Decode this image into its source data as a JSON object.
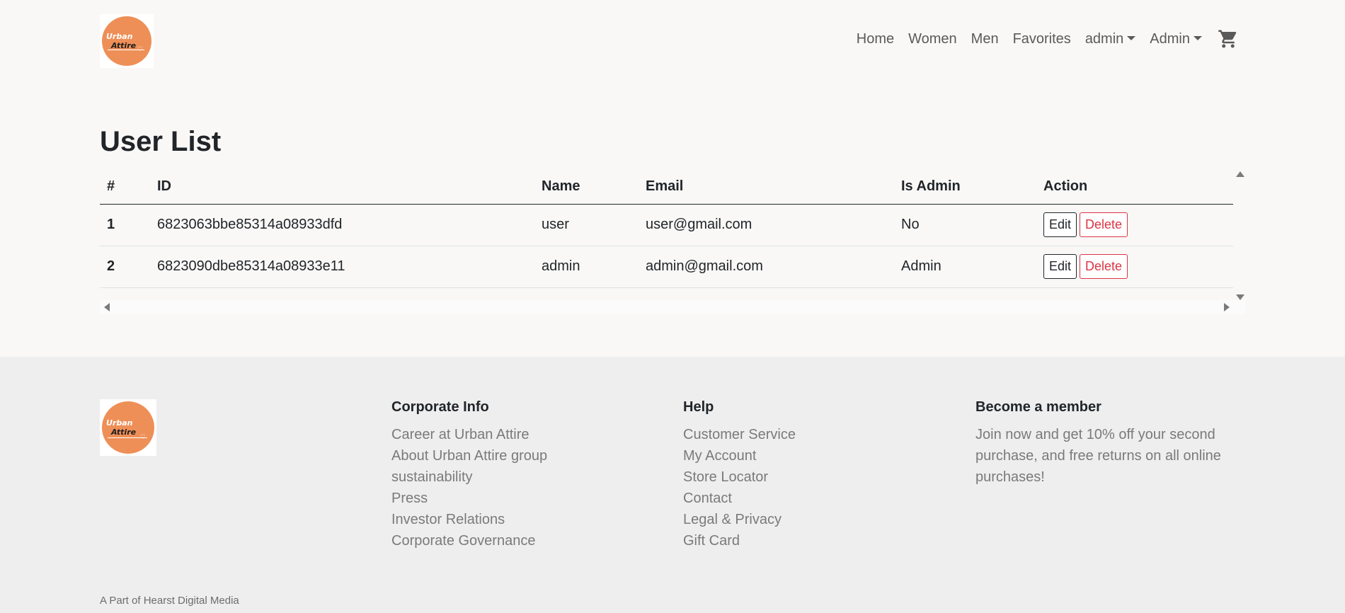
{
  "brand": {
    "logo_line1": "Urban",
    "logo_line2": "Attire",
    "accent_color": "#ee8f57"
  },
  "nav": {
    "items": [
      "Home",
      "Women",
      "Men",
      "Favorites"
    ],
    "user_dropdown": "admin",
    "admin_dropdown": "Admin",
    "cart_icon": "shopping-cart-icon"
  },
  "main": {
    "title": "User List",
    "table": {
      "headers": [
        "#",
        "ID",
        "Name",
        "Email",
        "Is Admin",
        "Action"
      ],
      "rows": [
        {
          "num": "1",
          "id": "6823063bbe85314a08933dfd",
          "name": "user",
          "email": "user@gmail.com",
          "is_admin": "No"
        },
        {
          "num": "2",
          "id": "6823090dbe85314a08933e11",
          "name": "admin",
          "email": "admin@gmail.com",
          "is_admin": "Admin"
        }
      ],
      "edit_label": "Edit",
      "delete_label": "Delete",
      "delete_color": "#dc3545"
    }
  },
  "footer": {
    "corporate": {
      "heading": "Corporate Info",
      "links": [
        "Career at Urban Attire",
        "About Urban Attire group",
        "sustainability",
        "Press",
        "Investor Relations",
        "Corporate Governance"
      ]
    },
    "help": {
      "heading": "Help",
      "links": [
        "Customer Service",
        "My Account",
        "Store Locator",
        "Contact",
        "Legal & Privacy",
        "Gift Card"
      ]
    },
    "member": {
      "heading": "Become a member",
      "text": "Join now and get 10% off your second purchase, and free returns on all online purchases!"
    },
    "copyright": "A Part of Hearst Digital Media"
  }
}
